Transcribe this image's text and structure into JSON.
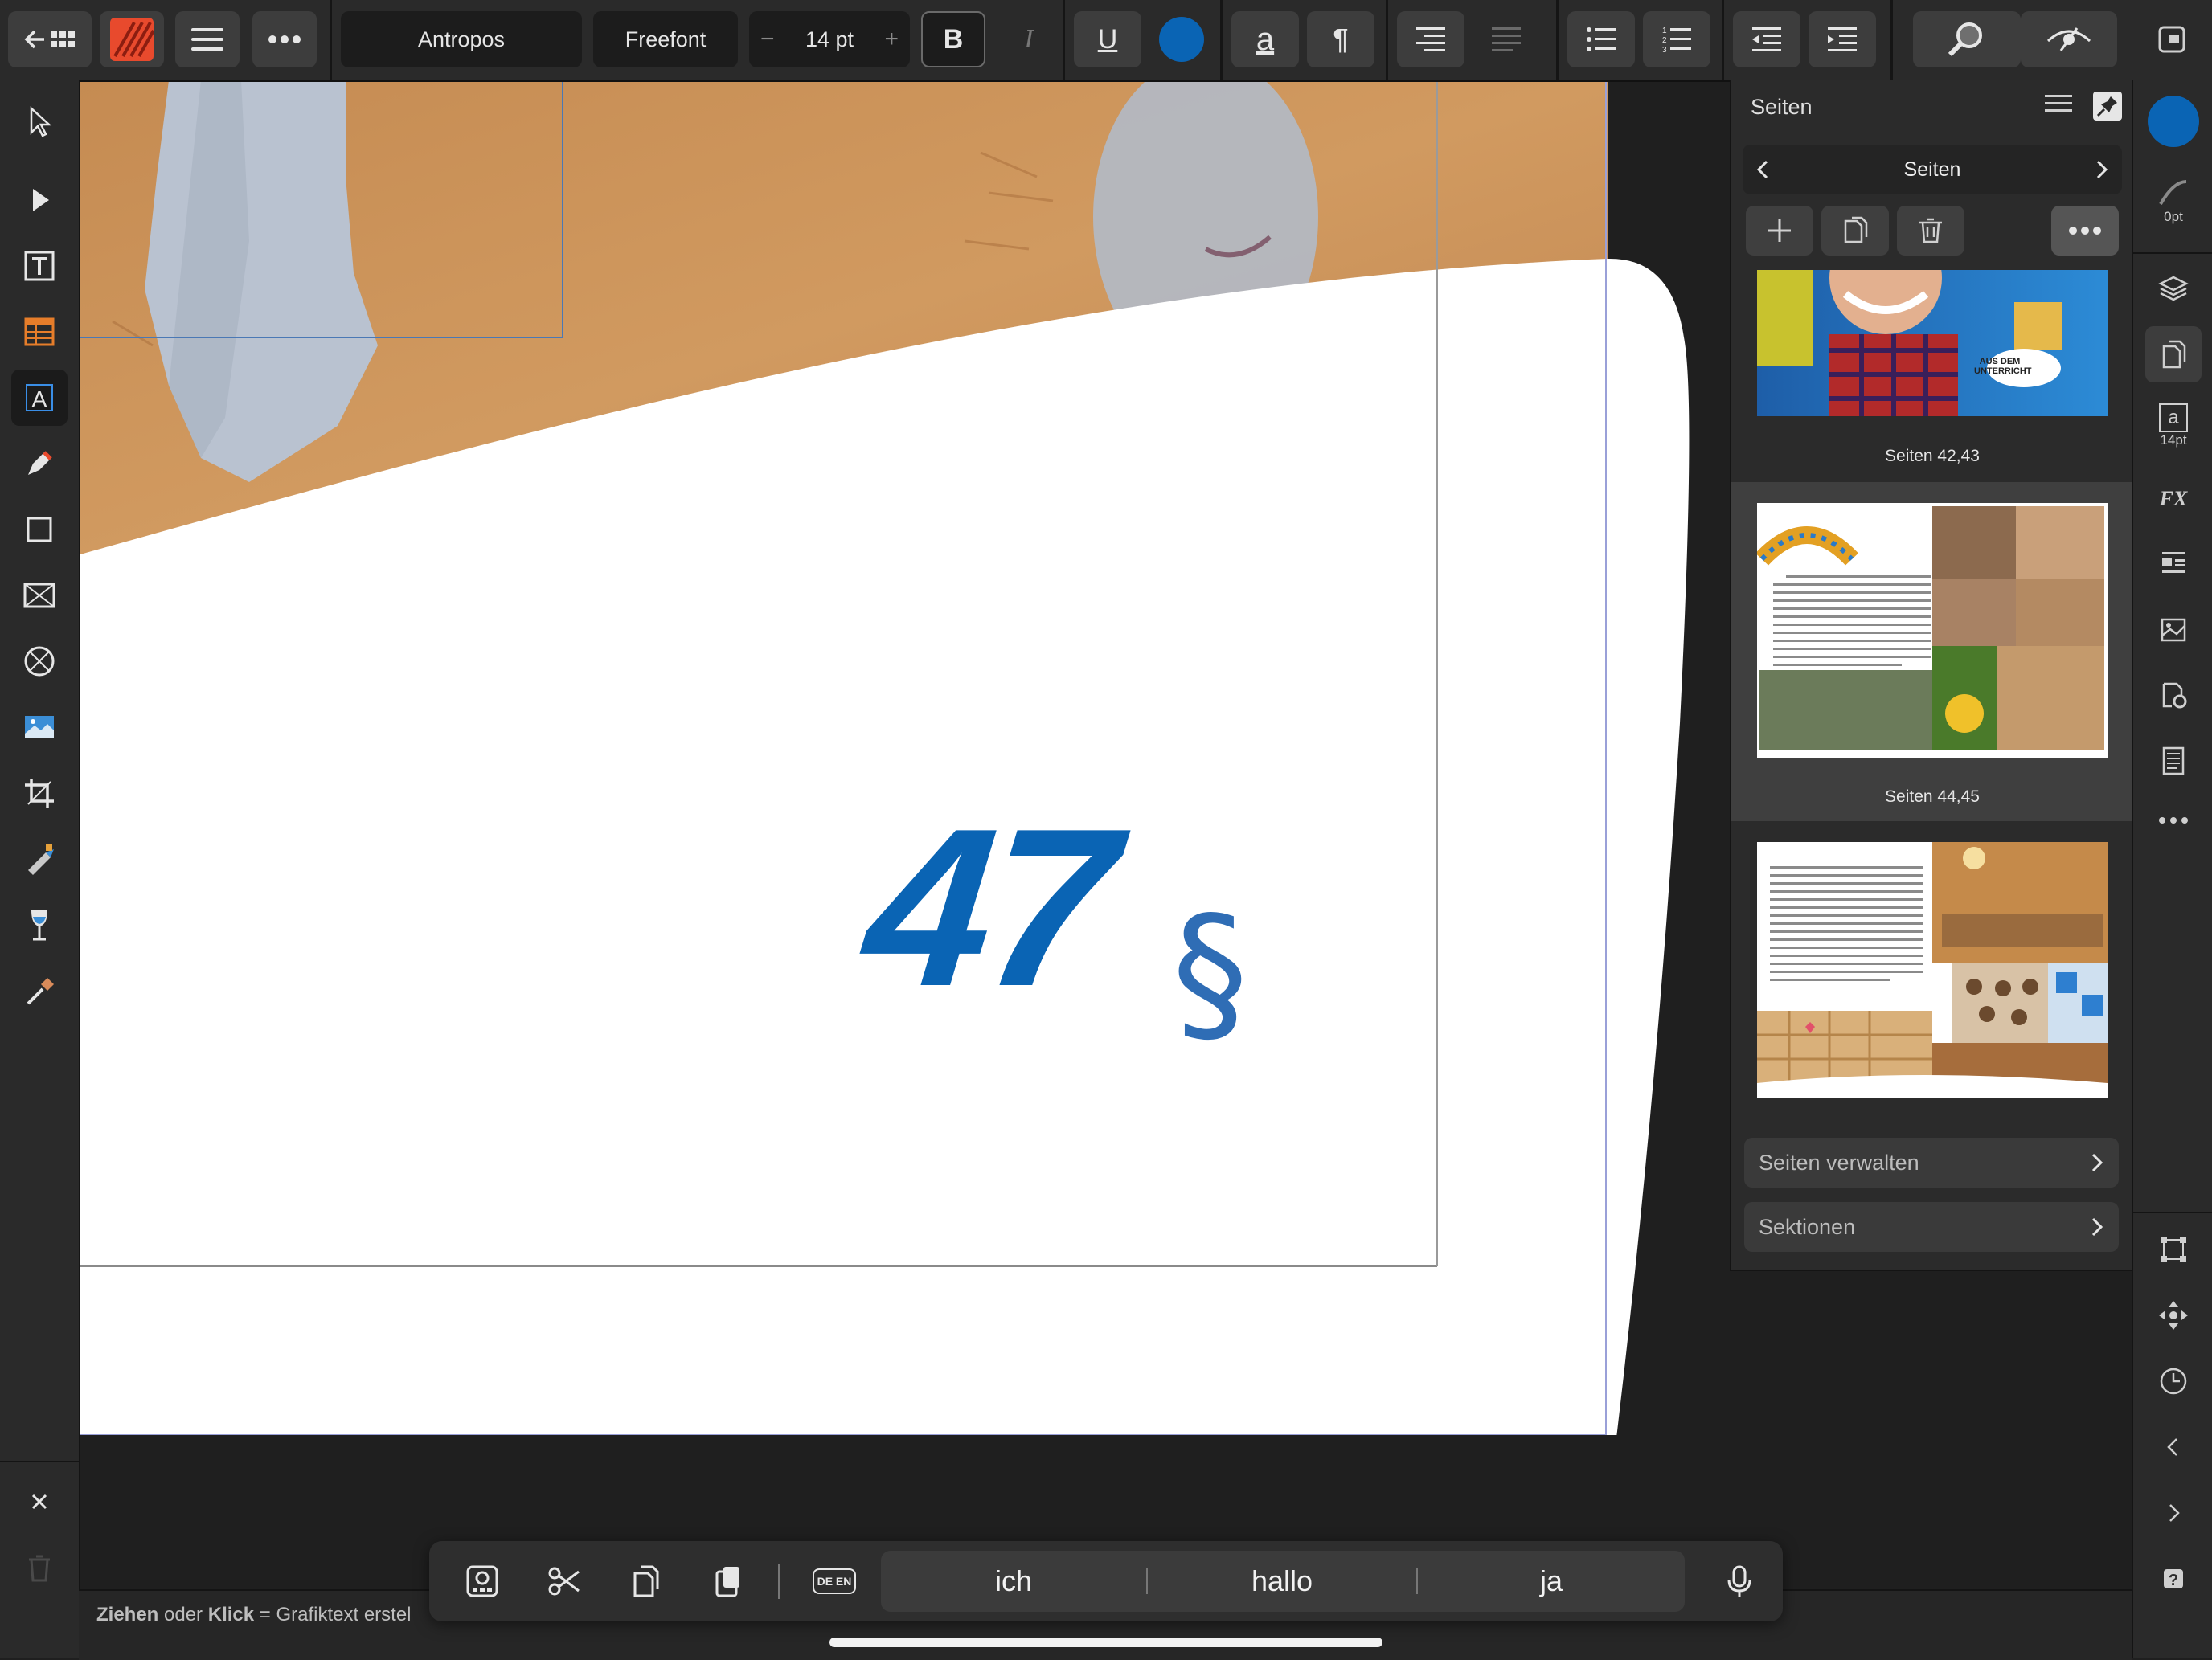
{
  "toolbar": {
    "font_family": "Antropos",
    "font_style": "Freefont",
    "font_size": "14 pt",
    "minus": "−",
    "plus": "+",
    "bold": "B",
    "italic": "I",
    "underline": "U",
    "text_color": "#0a64b4",
    "char_style": "a",
    "pilcrow": "¶"
  },
  "canvas": {
    "big_number": "47",
    "section_sign": "§",
    "number_color": "#0a64b4"
  },
  "pages_panel": {
    "title": "Seiten",
    "nav_title": "Seiten",
    "thumb_badge": "AUS DEM UNTERRICHT",
    "spreads": [
      {
        "label": "Seiten 42,43"
      },
      {
        "label": "Seiten 44,45"
      },
      {
        "label": ""
      }
    ],
    "manage": "Seiten verwalten",
    "sections": "Sektionen"
  },
  "right_strip": {
    "stroke_width": "0pt",
    "text_size": "14pt",
    "text_glyph": "a",
    "fill_color": "#0a64b4"
  },
  "status": {
    "drag": "Ziehen",
    "oder": "oder",
    "click": "Klick",
    "rest": "= Grafiktext erstel"
  },
  "keyboard": {
    "suggestions": [
      "ich",
      "hallo",
      "ja"
    ],
    "lang_badge": "DE EN"
  }
}
